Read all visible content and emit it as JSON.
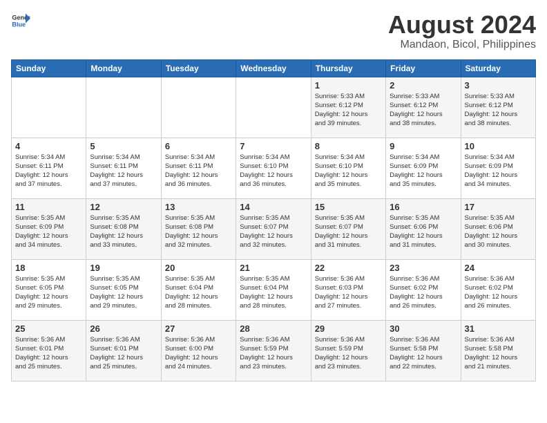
{
  "header": {
    "logo_general": "General",
    "logo_blue": "Blue",
    "month_title": "August 2024",
    "subtitle": "Mandaon, Bicol, Philippines"
  },
  "weekdays": [
    "Sunday",
    "Monday",
    "Tuesday",
    "Wednesday",
    "Thursday",
    "Friday",
    "Saturday"
  ],
  "weeks": [
    [
      {
        "day": "",
        "detail": ""
      },
      {
        "day": "",
        "detail": ""
      },
      {
        "day": "",
        "detail": ""
      },
      {
        "day": "",
        "detail": ""
      },
      {
        "day": "1",
        "detail": "Sunrise: 5:33 AM\nSunset: 6:12 PM\nDaylight: 12 hours\nand 39 minutes."
      },
      {
        "day": "2",
        "detail": "Sunrise: 5:33 AM\nSunset: 6:12 PM\nDaylight: 12 hours\nand 38 minutes."
      },
      {
        "day": "3",
        "detail": "Sunrise: 5:33 AM\nSunset: 6:12 PM\nDaylight: 12 hours\nand 38 minutes."
      }
    ],
    [
      {
        "day": "4",
        "detail": "Sunrise: 5:34 AM\nSunset: 6:11 PM\nDaylight: 12 hours\nand 37 minutes."
      },
      {
        "day": "5",
        "detail": "Sunrise: 5:34 AM\nSunset: 6:11 PM\nDaylight: 12 hours\nand 37 minutes."
      },
      {
        "day": "6",
        "detail": "Sunrise: 5:34 AM\nSunset: 6:11 PM\nDaylight: 12 hours\nand 36 minutes."
      },
      {
        "day": "7",
        "detail": "Sunrise: 5:34 AM\nSunset: 6:10 PM\nDaylight: 12 hours\nand 36 minutes."
      },
      {
        "day": "8",
        "detail": "Sunrise: 5:34 AM\nSunset: 6:10 PM\nDaylight: 12 hours\nand 35 minutes."
      },
      {
        "day": "9",
        "detail": "Sunrise: 5:34 AM\nSunset: 6:09 PM\nDaylight: 12 hours\nand 35 minutes."
      },
      {
        "day": "10",
        "detail": "Sunrise: 5:34 AM\nSunset: 6:09 PM\nDaylight: 12 hours\nand 34 minutes."
      }
    ],
    [
      {
        "day": "11",
        "detail": "Sunrise: 5:35 AM\nSunset: 6:09 PM\nDaylight: 12 hours\nand 34 minutes."
      },
      {
        "day": "12",
        "detail": "Sunrise: 5:35 AM\nSunset: 6:08 PM\nDaylight: 12 hours\nand 33 minutes."
      },
      {
        "day": "13",
        "detail": "Sunrise: 5:35 AM\nSunset: 6:08 PM\nDaylight: 12 hours\nand 32 minutes."
      },
      {
        "day": "14",
        "detail": "Sunrise: 5:35 AM\nSunset: 6:07 PM\nDaylight: 12 hours\nand 32 minutes."
      },
      {
        "day": "15",
        "detail": "Sunrise: 5:35 AM\nSunset: 6:07 PM\nDaylight: 12 hours\nand 31 minutes."
      },
      {
        "day": "16",
        "detail": "Sunrise: 5:35 AM\nSunset: 6:06 PM\nDaylight: 12 hours\nand 31 minutes."
      },
      {
        "day": "17",
        "detail": "Sunrise: 5:35 AM\nSunset: 6:06 PM\nDaylight: 12 hours\nand 30 minutes."
      }
    ],
    [
      {
        "day": "18",
        "detail": "Sunrise: 5:35 AM\nSunset: 6:05 PM\nDaylight: 12 hours\nand 29 minutes."
      },
      {
        "day": "19",
        "detail": "Sunrise: 5:35 AM\nSunset: 6:05 PM\nDaylight: 12 hours\nand 29 minutes."
      },
      {
        "day": "20",
        "detail": "Sunrise: 5:35 AM\nSunset: 6:04 PM\nDaylight: 12 hours\nand 28 minutes."
      },
      {
        "day": "21",
        "detail": "Sunrise: 5:35 AM\nSunset: 6:04 PM\nDaylight: 12 hours\nand 28 minutes."
      },
      {
        "day": "22",
        "detail": "Sunrise: 5:36 AM\nSunset: 6:03 PM\nDaylight: 12 hours\nand 27 minutes."
      },
      {
        "day": "23",
        "detail": "Sunrise: 5:36 AM\nSunset: 6:02 PM\nDaylight: 12 hours\nand 26 minutes."
      },
      {
        "day": "24",
        "detail": "Sunrise: 5:36 AM\nSunset: 6:02 PM\nDaylight: 12 hours\nand 26 minutes."
      }
    ],
    [
      {
        "day": "25",
        "detail": "Sunrise: 5:36 AM\nSunset: 6:01 PM\nDaylight: 12 hours\nand 25 minutes."
      },
      {
        "day": "26",
        "detail": "Sunrise: 5:36 AM\nSunset: 6:01 PM\nDaylight: 12 hours\nand 25 minutes."
      },
      {
        "day": "27",
        "detail": "Sunrise: 5:36 AM\nSunset: 6:00 PM\nDaylight: 12 hours\nand 24 minutes."
      },
      {
        "day": "28",
        "detail": "Sunrise: 5:36 AM\nSunset: 5:59 PM\nDaylight: 12 hours\nand 23 minutes."
      },
      {
        "day": "29",
        "detail": "Sunrise: 5:36 AM\nSunset: 5:59 PM\nDaylight: 12 hours\nand 23 minutes."
      },
      {
        "day": "30",
        "detail": "Sunrise: 5:36 AM\nSunset: 5:58 PM\nDaylight: 12 hours\nand 22 minutes."
      },
      {
        "day": "31",
        "detail": "Sunrise: 5:36 AM\nSunset: 5:58 PM\nDaylight: 12 hours\nand 21 minutes."
      }
    ]
  ]
}
